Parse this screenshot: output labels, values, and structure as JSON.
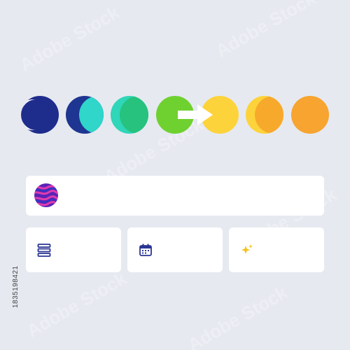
{
  "phases": [
    {
      "name": "phase-1",
      "base": "#1e2d8c",
      "accent": "#ffffff"
    },
    {
      "name": "phase-2",
      "base": "#1e3591",
      "accent": "#2fd6c9"
    },
    {
      "name": "phase-3",
      "base": "#2fd6b8",
      "accent": "#27c27e"
    },
    {
      "name": "phase-4",
      "base": "#6fd12f"
    },
    {
      "name": "phase-5",
      "base": "#fdd33b"
    },
    {
      "name": "phase-6",
      "base": "#fdd33b",
      "accent": "#f7a92c"
    },
    {
      "name": "phase-7",
      "base": "#f7a430"
    }
  ],
  "colors": {
    "background": "#e6e9f0",
    "card": "#ffffff",
    "icon_navy": "#2a3593",
    "icon_star": "#f4c21f",
    "avatar_purple": "#5a23b8",
    "avatar_pink": "#e03cae"
  },
  "cards": {
    "wide": {
      "icon": "swirl-avatar",
      "label": ""
    },
    "small": [
      {
        "icon": "list-icon",
        "label": ""
      },
      {
        "icon": "calendar-icon",
        "label": ""
      },
      {
        "icon": "sparkle-icon",
        "label": ""
      }
    ]
  },
  "side_code": "1835198421",
  "watermark_text": "Adobe Stock"
}
